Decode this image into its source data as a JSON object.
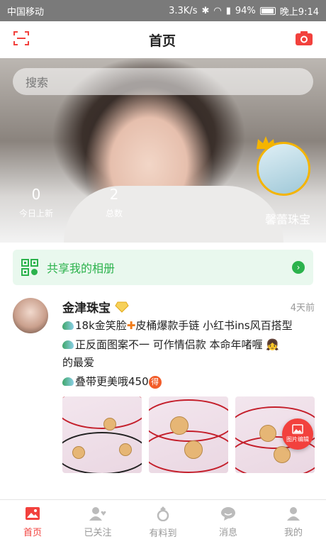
{
  "status_bar": {
    "carrier": "中国移动",
    "speed": "3.3K/s",
    "battery": "94%",
    "time": "晚上9:14"
  },
  "nav": {
    "title": "首页",
    "scan_icon": "scan-icon",
    "camera_icon": "camera-icon"
  },
  "hero": {
    "search_placeholder": "搜索",
    "stats": [
      {
        "value": "0",
        "label": "今日上新"
      },
      {
        "value": "2",
        "label": "总数"
      }
    ],
    "shop_name": "馨蕾珠宝"
  },
  "share_album": {
    "label": "共享我的相册"
  },
  "post": {
    "author": "金津珠宝",
    "time": "4天前",
    "lines": {
      "l1a": "18k金笑脸",
      "l1b": "皮桶爆款手链 小红书ins风百搭型",
      "l2": "正反面图案不一 可作情侣款 本命年啫喱",
      "l2b": "的最爱",
      "l3": "叠带更美哦450",
      "badge": "得"
    }
  },
  "fab": {
    "label": "图片编辑"
  },
  "tabbar": {
    "tabs": [
      {
        "label": "首页",
        "icon": "home-icon"
      },
      {
        "label": "已关注",
        "icon": "following-icon"
      },
      {
        "label": "有料到",
        "icon": "ring-icon"
      },
      {
        "label": "消息",
        "icon": "message-icon"
      },
      {
        "label": "我的",
        "icon": "profile-icon"
      }
    ]
  },
  "colors": {
    "accent": "#f2413d",
    "green": "#2bb24c"
  }
}
